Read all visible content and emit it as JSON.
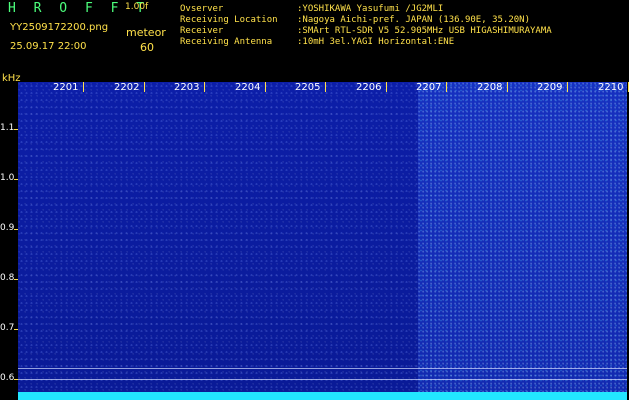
{
  "header": {
    "logo": "H R O F F T",
    "version": "1.00f",
    "filename": "YY2509172200.png",
    "datetime": "25.09.17 22:00",
    "mode_label": "meteor",
    "mode_value": "60",
    "observer_key": "Ovserver",
    "observer_val": ":YOSHIKAWA Yasufumi /JG2MLI",
    "location_key": "Receiving Location",
    "location_val": ":Nagoya Aichi-pref. JAPAN (136.90E, 35.20N)",
    "receiver_key": "Receiver",
    "receiver_val": ":SMArt RTL-SDR V5 52.905MHz USB HIGASHIMURAYAMA",
    "antenna_key": "Receiving Antenna",
    "antenna_val": ":10mH 3el.YAGI Horizontal:ENE"
  },
  "axes": {
    "y_unit": "kHz",
    "y_ticks": [
      "1.1",
      "1.0",
      "0.9",
      "0.8",
      "0.7",
      "0.6"
    ],
    "x_ticks": [
      "2201",
      "2202",
      "2203",
      "2204",
      "2205",
      "2206",
      "2207",
      "2208",
      "2209",
      "2210"
    ]
  }
}
